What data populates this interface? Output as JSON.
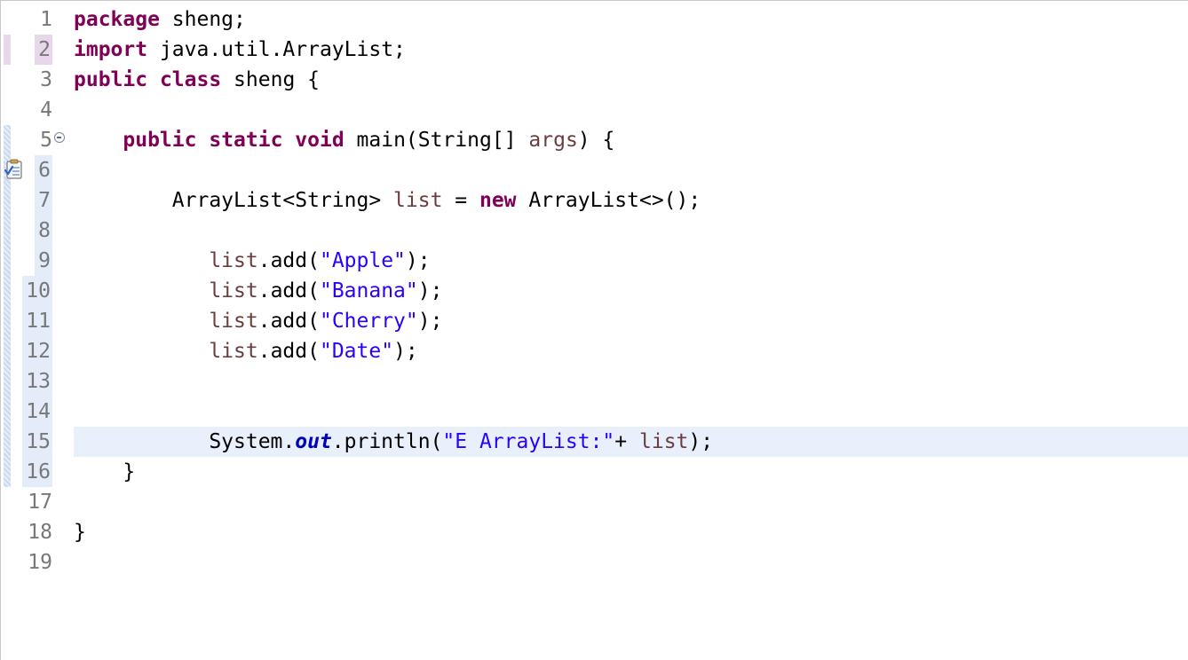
{
  "lines": [
    {
      "num": "1",
      "tokens": [
        "package",
        " sheng;"
      ]
    },
    {
      "num": "2",
      "tokens": [
        "import",
        " java.util.ArrayList;"
      ]
    },
    {
      "num": "3",
      "tokens": [
        "public",
        " ",
        "class",
        " sheng {"
      ]
    },
    {
      "num": "4",
      "tokens": []
    },
    {
      "num": "5",
      "tokens": [
        "    ",
        "public",
        " ",
        "static",
        " ",
        "void",
        " main(String[] ",
        "args",
        ") {"
      ]
    },
    {
      "num": "6",
      "tokens": []
    },
    {
      "num": "7",
      "tokens": [
        "        ArrayList<String> ",
        "list",
        " = ",
        "new",
        " ArrayList<>();"
      ]
    },
    {
      "num": "8",
      "tokens": []
    },
    {
      "num": "9",
      "tokens": [
        "           ",
        "list",
        ".add(",
        "\"Apple\"",
        ");"
      ]
    },
    {
      "num": "10",
      "tokens": [
        "           ",
        "list",
        ".add(",
        "\"Banana\"",
        ");"
      ]
    },
    {
      "num": "11",
      "tokens": [
        "           ",
        "list",
        ".add(",
        "\"Cherry\"",
        ");"
      ]
    },
    {
      "num": "12",
      "tokens": [
        "           ",
        "list",
        ".add(",
        "\"Date\"",
        ");"
      ]
    },
    {
      "num": "13",
      "tokens": []
    },
    {
      "num": "14",
      "tokens": []
    },
    {
      "num": "15",
      "tokens": [
        "           System.",
        "out",
        ".println(",
        "\"E ArrayList:\"",
        "+ ",
        "list",
        ");"
      ]
    },
    {
      "num": "16",
      "tokens": [
        "    }"
      ]
    },
    {
      "num": "17",
      "tokens": []
    },
    {
      "num": "18",
      "tokens": [
        "}"
      ]
    },
    {
      "num": "19",
      "tokens": []
    }
  ],
  "current_line": "15",
  "icons": {
    "fold": "collapse-minus-icon",
    "task": "task-clipboard-icon"
  },
  "colors": {
    "keyword": "#7f0055",
    "string": "#2a00ff",
    "local_variable": "#6a3e3e",
    "static_field": "#0000c0",
    "line_number": "#787878",
    "current_line_highlight": "#e8f0fb"
  }
}
